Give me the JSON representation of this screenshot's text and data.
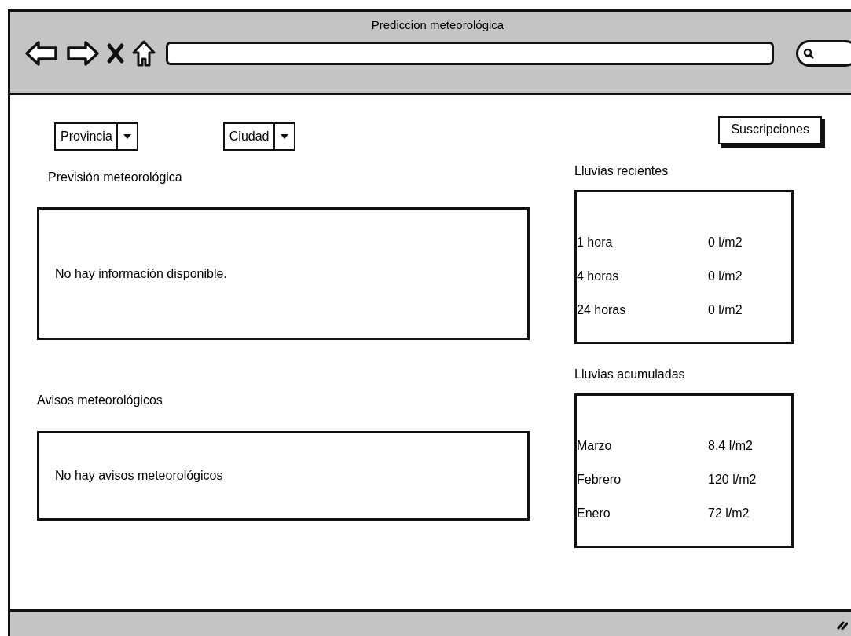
{
  "window": {
    "title": "Prediccion meteorológica"
  },
  "filters": [
    {
      "label": "Provincia"
    },
    {
      "label": "Ciudad"
    }
  ],
  "subscriptions_button": {
    "label": "Suscripciones"
  },
  "forecast": {
    "title": "Previsión meteorológica",
    "message": "No hay información disponible."
  },
  "warnings": {
    "title": "Avisos meteorológicos",
    "message": "No hay avisos meteorológicos"
  },
  "recent_rain": {
    "title": "Lluvias recientes",
    "rows": [
      {
        "period": "1 hora",
        "amount": "0 l/m2"
      },
      {
        "period": "4 horas",
        "amount": "0 l/m2"
      },
      {
        "period": "24 horas",
        "amount": "0 l/m2"
      }
    ]
  },
  "accumulated_rain": {
    "title": "Lluvias acumuladas",
    "rows": [
      {
        "period": "Marzo",
        "amount": "8.4 l/m2"
      },
      {
        "period": "Febrero",
        "amount": "120 l/m2"
      },
      {
        "period": "Enero",
        "amount": "72 l/m2"
      }
    ]
  }
}
